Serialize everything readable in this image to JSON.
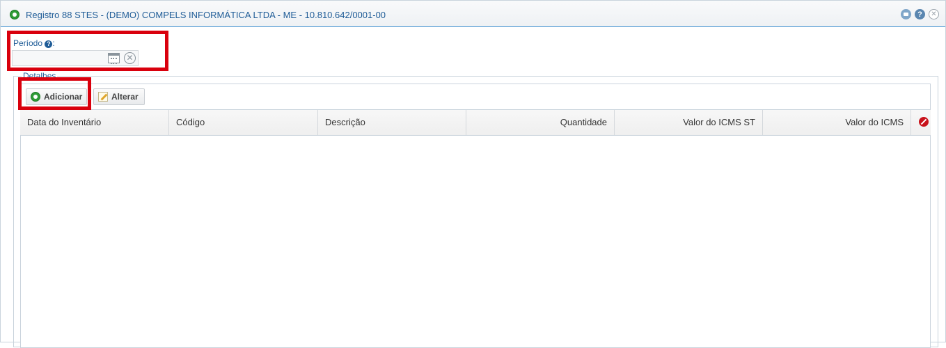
{
  "window": {
    "title": "Registro 88 STES - (DEMO) COMPELS INFORMÁTICA LTDA - ME - 10.810.642/0001-00",
    "help_glyph": "?",
    "close_glyph": "✕"
  },
  "periodo": {
    "label": "Período",
    "label_suffix": ":",
    "help_glyph": "?",
    "value": "",
    "clear_glyph": "✕"
  },
  "detalhes": {
    "legend": "Detalhes",
    "toolbar": {
      "add_label": "Adicionar",
      "edit_label": "Alterar"
    },
    "table": {
      "columns": [
        "Data do Inventário",
        "Código",
        "Descrição",
        "Quantidade",
        "Valor do ICMS ST",
        "Valor do ICMS"
      ],
      "rows": []
    }
  },
  "colors": {
    "accent": "#1f5c97",
    "highlight_box": "#d9000d",
    "add_icon": "#2e9b36",
    "delete_icon": "#c8121b"
  },
  "icons": [
    "add-icon",
    "minimize-icon",
    "help-icon",
    "close-icon",
    "calendar-icon",
    "clear-icon",
    "edit-icon",
    "delete-icon"
  ]
}
